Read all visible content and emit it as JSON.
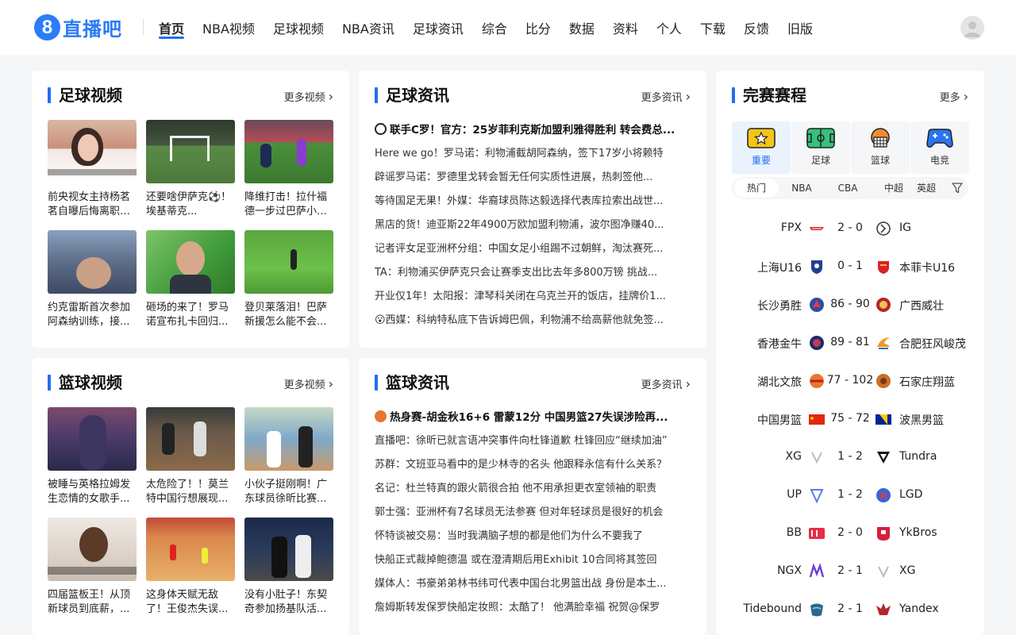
{
  "header": {
    "logo_mark": "8",
    "logo_text": "直播吧",
    "nav": [
      "首页",
      "NBA视频",
      "足球视频",
      "NBA资讯",
      "足球资讯",
      "综合",
      "比分",
      "数据",
      "资料",
      "个人",
      "下载",
      "反馈",
      "旧版"
    ],
    "active_nav": "首页"
  },
  "football_video": {
    "title": "足球视频",
    "more": "更多视频",
    "items": [
      {
        "caption": "前央视女主持杨茗茗自曝后悔离职：在央视当主持人可能一辈子..."
      },
      {
        "caption": "还要啥伊萨克⚽！埃基蒂克..."
      },
      {
        "caption": "降维打击！拉什福德一步过巴萨小将..."
      },
      {
        "caption": "约克雷斯首次参加阿森纳训练，接..."
      },
      {
        "caption": "砸场的来了！罗马诺宣布扎卡回归..."
      },
      {
        "caption": "登贝莱落泪！巴萨新援怎么能不会..."
      }
    ]
  },
  "football_news": {
    "title": "足球资讯",
    "more": "更多资讯",
    "items": [
      "联手C罗！官方：25岁菲利克斯加盟利雅得胜利 转会费总...",
      "Here we go！罗马诺：利物浦截胡阿森纳，签下17岁小将赖特",
      "辟谣罗马诺：罗德里戈转会暂无任何实质性进展，热刺签他...",
      "等待国足无果！外媒：华裔球员陈达毅选择代表库拉索出战世...",
      "黑店的货！迪亚斯22年4900万欧加盟利物浦，波尔图净赚40...",
      "记者评女足亚洲杯分组：中国女足小组踢不过朝鲜，淘汰赛死...",
      "TA：利物浦买伊萨克只会让赛季支出比去年多800万镑 挑战...",
      "开业仅1年！太阳报：津琴科关闭在乌克兰开的饭店，挂牌价1...",
      "😮西媒：科纳特私底下告诉姆巴佩，利物浦不给高薪他就免签..."
    ]
  },
  "schedule": {
    "title": "完赛赛程",
    "more": "更多",
    "categories": [
      "重要",
      "足球",
      "篮球",
      "电竞"
    ],
    "tabs": [
      "热门",
      "NBA",
      "CBA",
      "中超",
      "英超"
    ],
    "matches": [
      {
        "home": "FPX",
        "score": "2 - 0",
        "away": "IG"
      },
      {
        "home": "上海U16",
        "score": "0 - 1",
        "away": "本菲卡U16"
      },
      {
        "home": "长沙勇胜",
        "score": "86 - 90",
        "away": "广西威壮"
      },
      {
        "home": "香港金牛",
        "score": "89 - 81",
        "away": "合肥狂风峻茂"
      },
      {
        "home": "湖北文旅",
        "score": "77 - 102",
        "away": "石家庄翔蓝"
      },
      {
        "home": "中国男篮",
        "score": "75 - 72",
        "away": "波黑男篮"
      },
      {
        "home": "XG",
        "score": "1 - 2",
        "away": "Tundra"
      },
      {
        "home": "UP",
        "score": "1 - 2",
        "away": "LGD"
      },
      {
        "home": "BB",
        "score": "2 - 0",
        "away": "YkBros"
      },
      {
        "home": "NGX",
        "score": "2 - 1",
        "away": "XG"
      },
      {
        "home": "Tidebound",
        "score": "2 - 1",
        "away": "Yandex"
      }
    ]
  },
  "basketball_video": {
    "title": "篮球视频",
    "more": "更多视频",
    "items": [
      {
        "caption": "被睡与英格拉姆发生恋情的女歌手..."
      },
      {
        "caption": "太危险了！！莫兰特中国行想展现..."
      },
      {
        "caption": "小伙子挺刚啊！广东球员徐昕比赛..."
      },
      {
        "caption": "四届篮板王！从顶新球员到底薪，..."
      },
      {
        "caption": "这身体天赋无敌了！王俊杰失误..."
      },
      {
        "caption": "没有小肚子！东契奇参加扬基队活..."
      }
    ]
  },
  "basketball_news": {
    "title": "篮球资讯",
    "more": "更多资讯",
    "items": [
      "热身赛-胡金秋16+6 雷蒙12分 中国男篮27失误涉险再...",
      "直播吧：徐昕已就言语冲突事件向杜锋道歉 杜锋回应“继续加油”",
      "苏群：文班亚马看中的是少林寺的名头 他跟释永信有什么关系？",
      "名记：杜兰特真的跟火箭很合拍 他不用承担更衣室领袖的职责",
      "郭士强：亚洲杯有7名球员无法参赛 但对年轻球员是很好的机会",
      "怀特谈被交易：当时我满脑子想的都是他们为什么不要我了",
      "快船正式裁掉鲍德温 或在澄清期后用Exhibit 10合同将其签回",
      "媒体人：书豪弟弟林书纬可代表中国台北男篮出战 身份是本土...",
      "詹姆斯转发保罗快船定妆照：太酷了！ 他满脸幸福 祝贺@保罗"
    ]
  }
}
